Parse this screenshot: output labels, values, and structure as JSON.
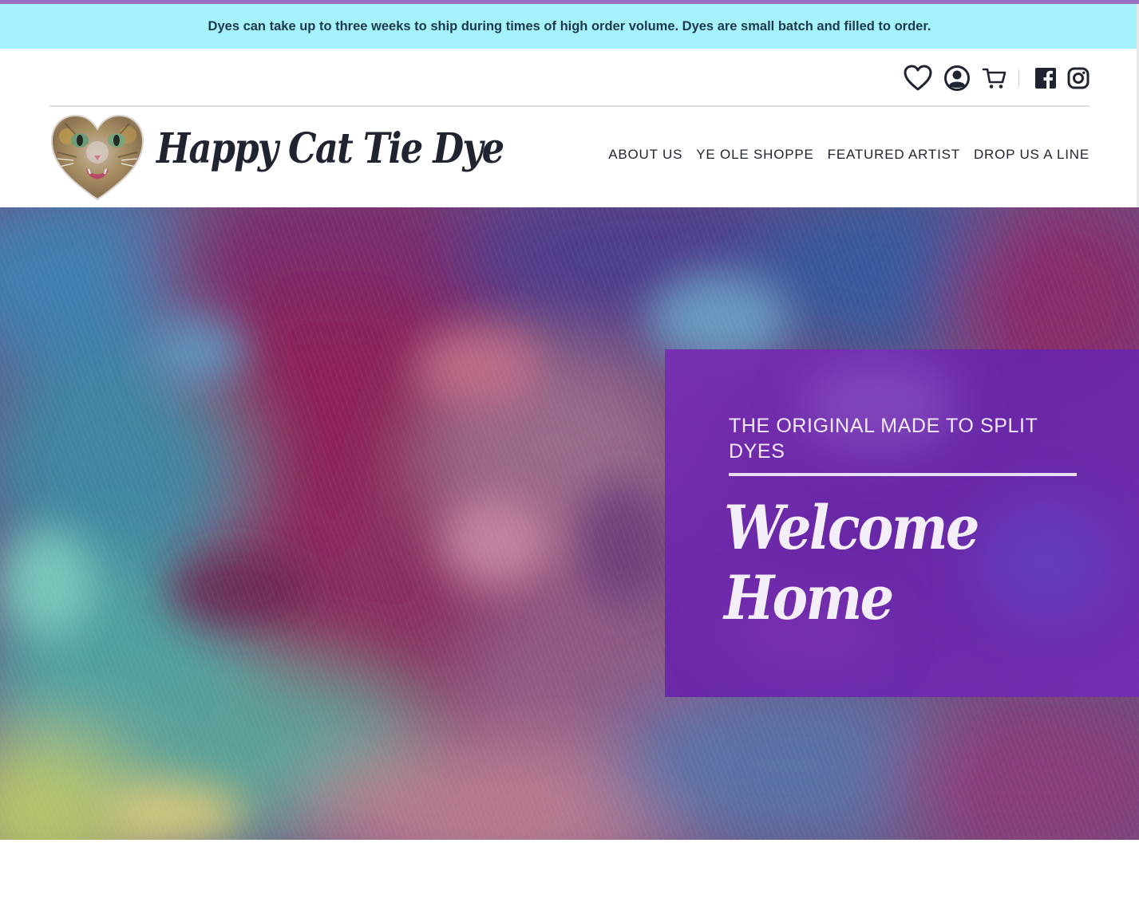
{
  "announcement": {
    "text": "Dyes can take up to three weeks to ship during times of high order volume. Dyes are small batch and filled to order."
  },
  "utility_icons": [
    {
      "icon": "heart-icon"
    },
    {
      "icon": "account-icon"
    },
    {
      "icon": "cart-icon"
    },
    {
      "icon": "facebook-icon"
    },
    {
      "icon": "instagram-icon"
    }
  ],
  "header": {
    "site_title": "Happy Cat Tie Dye",
    "logo": "cat-heart-logo"
  },
  "nav": {
    "items": [
      {
        "label": "ABOUT US"
      },
      {
        "label": "YE OLE SHOPPE"
      },
      {
        "label": "FEATURED ARTIST"
      },
      {
        "label": "DROP US A LINE"
      }
    ]
  },
  "hero": {
    "kicker": "THE ORIGINAL MADE TO SPLIT DYES",
    "headline": "Welcome Home"
  },
  "colors": {
    "announcement_bg": "#a5f2fa",
    "announcement_text": "#1d3a4c",
    "accent_purple": "#6a24aa",
    "text_dark": "#1f2430"
  }
}
